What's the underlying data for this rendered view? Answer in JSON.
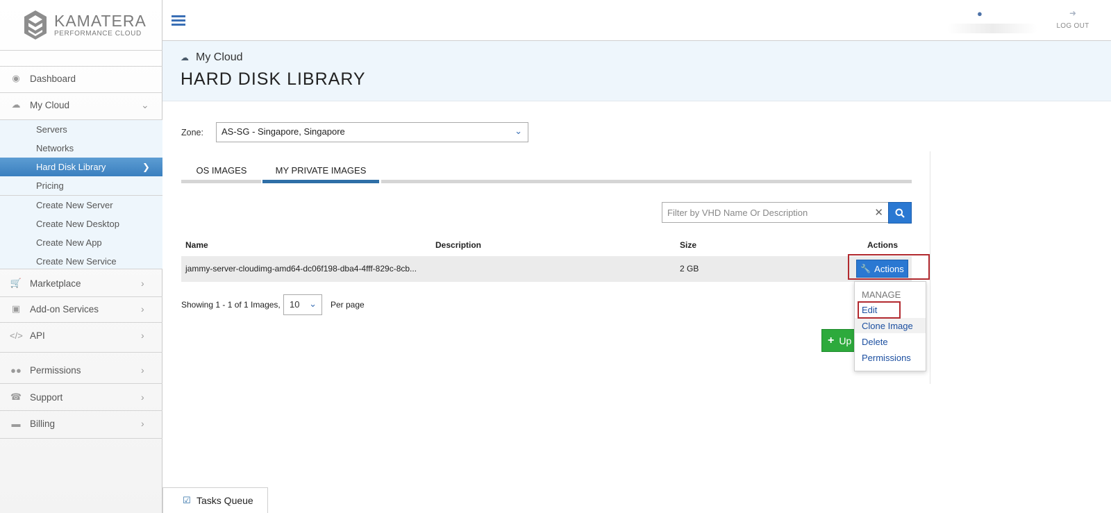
{
  "brand": {
    "name": "KAMATERA",
    "tagline": "PERFORMANCE CLOUD"
  },
  "sidebar": {
    "items": [
      {
        "label": "Dashboard",
        "icon": "dashboard-icon"
      },
      {
        "label": "My Cloud",
        "icon": "cloud-icon"
      },
      {
        "label": "Marketplace",
        "icon": "cart-icon"
      },
      {
        "label": "Add-on Services",
        "icon": "puzzle-icon"
      },
      {
        "label": "API",
        "icon": "code-icon"
      },
      {
        "label": "Permissions",
        "icon": "users-icon"
      },
      {
        "label": "Support",
        "icon": "headset-icon"
      },
      {
        "label": "Billing",
        "icon": "credit-card-icon"
      }
    ],
    "subitems": [
      {
        "label": "Servers"
      },
      {
        "label": "Networks"
      },
      {
        "label": "Hard Disk Library",
        "active": true
      },
      {
        "label": "Pricing"
      },
      {
        "label": "Create New Server"
      },
      {
        "label": "Create New Desktop"
      },
      {
        "label": "Create New App"
      },
      {
        "label": "Create New Service"
      }
    ]
  },
  "topbar": {
    "logout_label": "LOG OUT"
  },
  "header": {
    "breadcrumb": "My Cloud",
    "title": "HARD DISK LIBRARY"
  },
  "zone": {
    "label": "Zone:",
    "selected": "AS-SG - Singapore, Singapore"
  },
  "tabs": [
    {
      "label": "OS IMAGES",
      "active": false
    },
    {
      "label": "MY PRIVATE IMAGES",
      "active": true
    }
  ],
  "filter": {
    "placeholder": "Filter by VHD Name Or Description",
    "value": ""
  },
  "table": {
    "columns": [
      "Name",
      "Description",
      "Size",
      "Actions"
    ],
    "rows": [
      {
        "name": "jammy-server-cloudimg-amd64-dc06f198-dba4-4fff-829c-8cb...",
        "description": "",
        "size": "2 GB",
        "action_label": "Actions"
      }
    ]
  },
  "dropdown": {
    "header": "MANAGE",
    "items": [
      "Edit",
      "Clone Image",
      "Delete",
      "Permissions"
    ]
  },
  "pagination": {
    "showing": "Showing 1 - 1 of 1 Images,",
    "per_page_value": "10",
    "per_page_label": "Per page"
  },
  "upload": {
    "label": "Up"
  },
  "tasks": {
    "label": "Tasks Queue"
  },
  "colors": {
    "primary": "#2a78d2",
    "active_nav": "#3a7fbf",
    "success": "#2daa3c",
    "highlight": "#b22a2f"
  }
}
